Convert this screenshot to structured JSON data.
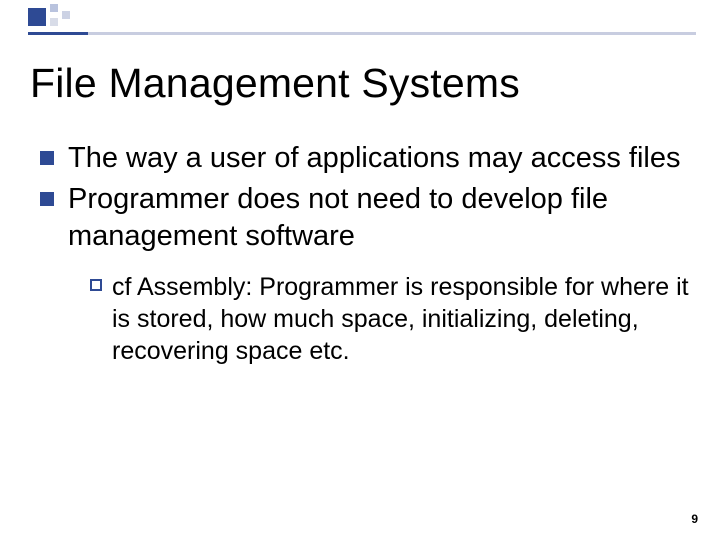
{
  "title": "File Management Systems",
  "bullets": [
    {
      "text": "The way a user of applications may access files"
    },
    {
      "text": "Programmer does not need to develop file management software"
    }
  ],
  "subbullets": [
    {
      "text": "cf Assembly: Programmer is responsible for where it is stored, how much space, initializing, deleting, recovering space etc."
    }
  ],
  "page_number": "9"
}
